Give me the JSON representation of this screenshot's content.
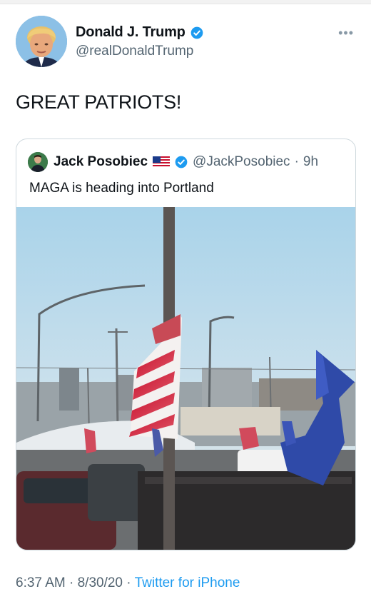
{
  "author": {
    "display_name": "Donald J. Trump",
    "handle": "@realDonaldTrump",
    "verified": true,
    "avatar_icon": "profile-photo"
  },
  "tweet": {
    "text": "GREAT PATRIOTS!",
    "more_icon": "ellipsis-icon"
  },
  "quoted": {
    "display_name": "Jack Posobiec",
    "flag_icon": "us-flag-icon",
    "handle": "@JackPosobiec",
    "separator": "·",
    "age": "9h",
    "text": "MAGA is heading into Portland",
    "media_icon": "video-thumbnail"
  },
  "footer": {
    "time": "6:37 AM",
    "sep1": "·",
    "date": "8/30/20",
    "sep2": "·",
    "source": "Twitter for iPhone"
  },
  "colors": {
    "verified": "#1d9bf0",
    "link": "#1d9bf0",
    "muted": "#536471",
    "border": "#cfd9de"
  }
}
